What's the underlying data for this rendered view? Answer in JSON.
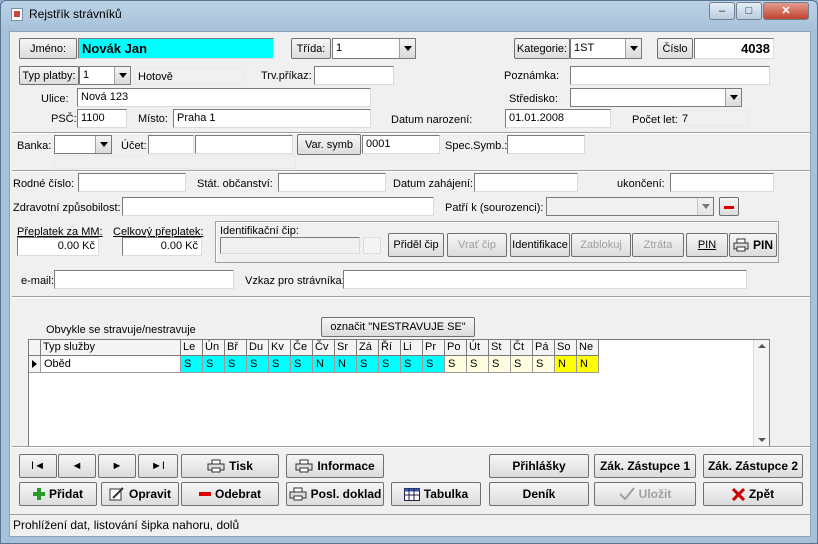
{
  "window": {
    "title": "Rejstřík strávníků",
    "min": "–",
    "max": "□",
    "close": "✕"
  },
  "header": {
    "jmeno_btn": "Jméno:",
    "jmeno_value": "Novák Jan",
    "trida_btn": "Třída:",
    "trida_value": "1",
    "kategorie_btn": "Kategorie:",
    "kategorie_value": "1ST",
    "cislo_btn": "Číslo",
    "cislo_value": "4038"
  },
  "form": {
    "typ_platby_btn": "Typ platby:",
    "typ_platby_value": "1",
    "typ_platby_text": "Hotově",
    "trv_prikaz_label": "Trv.příkaz:",
    "trv_prikaz_value": "",
    "poznamka_label": "Poznámka:",
    "poznamka_value": "",
    "ulice_label": "Ulice:",
    "ulice_value": "Nová 123",
    "stredisko_label": "Středisko:",
    "stredisko_value": "",
    "psc_label": "PSČ:",
    "psc_value": "1100",
    "misto_label": "Místo:",
    "misto_value": "Praha 1",
    "datum_narozeni_label": "Datum narození:",
    "datum_narozeni_value": "01.01.2008",
    "pocet_let_label": "Počet let:",
    "pocet_let_value": "7",
    "banka_label": "Banka:",
    "banka_value": "",
    "ucet_label": "Účet:",
    "ucet_value1": "",
    "ucet_value2": "",
    "var_symb_btn": "Var. symb",
    "var_symb_value": "0001",
    "spec_symb_label": "Spec.Symb.:",
    "spec_symb_value": "",
    "rodne_cislo_label": "Rodné číslo:",
    "rodne_cislo_value": "",
    "stat_obcanstvi_label": "Stát. občanství:",
    "stat_obcanstvi_value": "",
    "datum_zahajeni_label": "Datum zahájení:",
    "datum_zahajeni_value": "",
    "ukonceni_label": "ukončení:",
    "ukonceni_value": "",
    "zdravotni_label": "Zdravotní způsobilost:",
    "zdravotni_value": "",
    "patri_k_label": "Patří k (sourozenci):",
    "patri_k_value": "",
    "preplatek_mm_label": "Přeplatek za MM:",
    "preplatek_mm_value": "0.00 Kč",
    "celkovy_preplatek_label": "Celkový přeplatek:",
    "celkovy_preplatek_value": "0.00 Kč",
    "identifikacni_cip_label": "Identifikační čip:",
    "identifikacni_cip_value": "",
    "email_label": "e-mail:",
    "email_value": "",
    "vzkaz_label": "Vzkaz pro strávníka:",
    "vzkaz_value": ""
  },
  "chip_buttons": {
    "pridel": "Přiděl čip",
    "vrat": "Vrať čip",
    "identifikace": "Identifikace",
    "zablokuj": "Zablokuj",
    "ztrata": "Ztráta",
    "pin": "PIN",
    "print_pin": "PIN"
  },
  "meals": {
    "caption": "Obvykle se stravuje/nestravuje",
    "mark_btn": "označit \"NESTRAVUJE SE\"",
    "columns": [
      "Typ služby",
      "Le",
      "Ún",
      "Bř",
      "Du",
      "Kv",
      "Če",
      "Čv",
      "Sr",
      "Zá",
      "Ří",
      "Li",
      "Pr",
      "Po",
      "Út",
      "St",
      "Čt",
      "Pá",
      "So",
      "Ne"
    ],
    "rows": [
      {
        "name": "Oběd",
        "values": [
          "S",
          "S",
          "S",
          "S",
          "S",
          "S",
          "N",
          "N",
          "S",
          "S",
          "S",
          "S",
          "S",
          "S",
          "S",
          "S",
          "S",
          "N",
          "N"
        ]
      }
    ],
    "colors": {
      "month": "#00ffff",
      "weekday": "#fffde0",
      "weekend": "#ffff00"
    }
  },
  "nav": {
    "first": "I◄",
    "prev": "◄",
    "next": "►",
    "last": "►I"
  },
  "actions": {
    "tisk": "Tisk",
    "informace": "Informace",
    "prihlasky": "Přihlášky",
    "zak_zastupce1": "Zák. Zástupce 1",
    "zak_zastupce2": "Zák. Zástupce 2",
    "pridat": "Přidat",
    "opravit": "Opravit",
    "odebrat": "Odebrat",
    "posl_doklad": "Posl. doklad",
    "tabulka": "Tabulka",
    "denik": "Deník",
    "ulozit": "Uložit",
    "zpet": "Zpět"
  },
  "status": "Prohlížení dat, listování šipka nahoru, dolů"
}
